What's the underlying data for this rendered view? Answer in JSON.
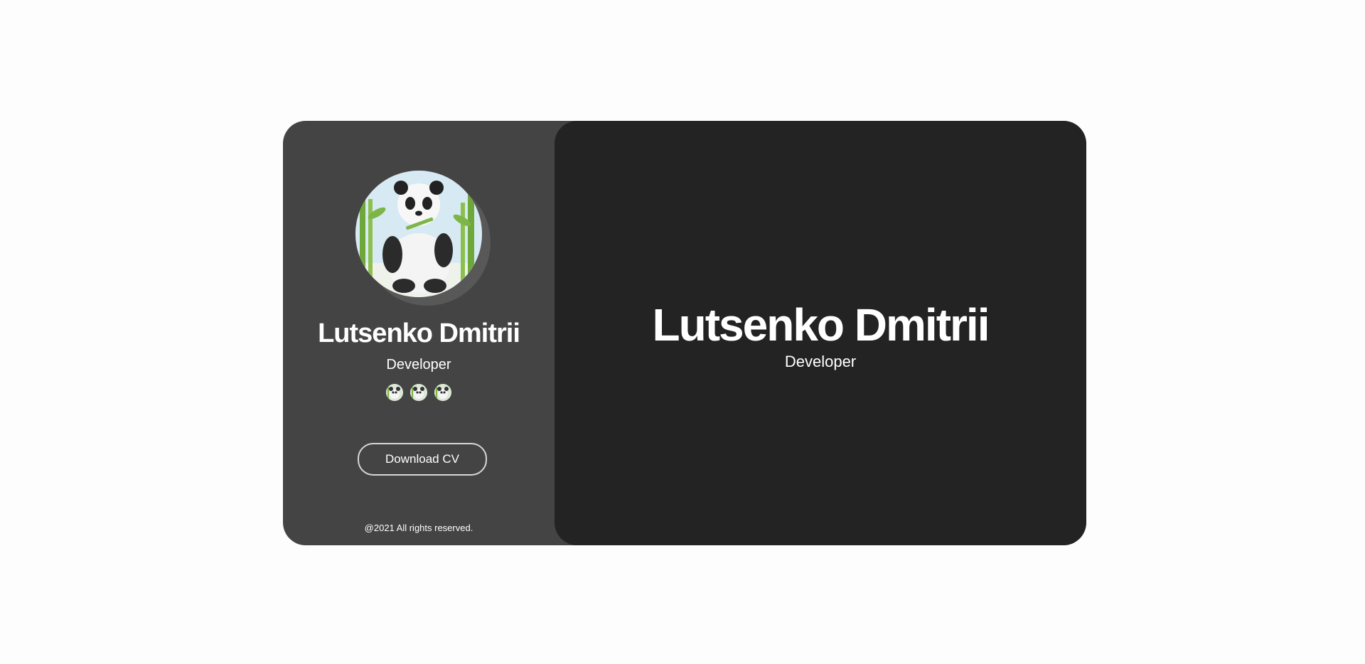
{
  "profile": {
    "name": "Lutsenko Dmitrii",
    "role": "Developer",
    "avatar_icon": "panda-avatar",
    "social_icons": [
      "panda-icon",
      "panda-icon",
      "panda-icon"
    ],
    "cv_button": "Download CV",
    "footer": "@2021 All rights reserved."
  },
  "hero": {
    "name": "Lutsenko Dmitrii",
    "role": "Developer"
  },
  "colors": {
    "page_bg": "#fdfdfd",
    "sidebar_bg": "#444444",
    "main_bg": "#232323",
    "text": "#ffffff"
  }
}
